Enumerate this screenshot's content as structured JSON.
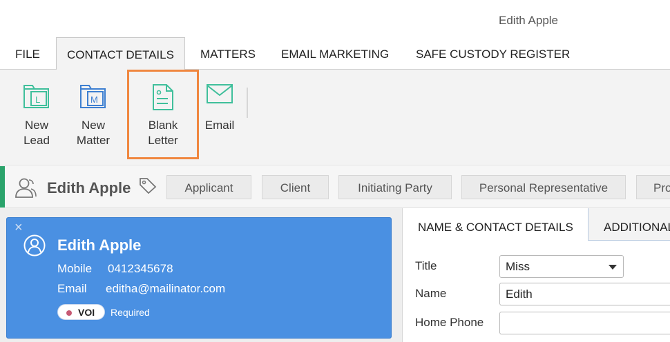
{
  "window": {
    "user_name": "Edith Apple"
  },
  "menu": {
    "tabs": [
      {
        "label": "FILE"
      },
      {
        "label": "CONTACT DETAILS"
      },
      {
        "label": "MATTERS"
      },
      {
        "label": "EMAIL MARKETING"
      },
      {
        "label": "SAFE CUSTODY REGISTER"
      }
    ],
    "active_tab": "CONTACT DETAILS"
  },
  "ribbon": {
    "buttons": [
      {
        "label_line1": "New",
        "label_line2": "Lead",
        "icon": "folder-l-icon"
      },
      {
        "label_line1": "New",
        "label_line2": "Matter",
        "icon": "folder-m-icon"
      },
      {
        "label_line1": "Blank",
        "label_line2": "Letter",
        "icon": "document-icon"
      },
      {
        "label_line1": "Email",
        "label_line2": "",
        "icon": "envelope-icon"
      }
    ],
    "highlighted": "Blank Letter",
    "colors": {
      "icon_teal": "#3fbf9b",
      "icon_blue": "#3d7fd1",
      "highlight": "#f0873f"
    }
  },
  "contact_bar": {
    "name": "Edith Apple",
    "roles": [
      "Applicant",
      "Client",
      "Initiating Party",
      "Personal Representative",
      "Pro"
    ],
    "accent_color": "#2aa36b"
  },
  "contact_card": {
    "name": "Edith Apple",
    "mobile_label": "Mobile",
    "mobile_value": "0412345678",
    "email_label": "Email",
    "email_value": "editha@mailinator.com",
    "badge": "VOI",
    "badge_status": "Required",
    "color": "#4a90e2"
  },
  "details_panel": {
    "tabs": [
      {
        "label": "NAME & CONTACT DETAILS"
      },
      {
        "label": "ADDITIONAL"
      }
    ],
    "fields": {
      "title_label": "Title",
      "title_value": "Miss",
      "name_label": "Name",
      "name_value": "Edith",
      "home_phone_label": "Home Phone",
      "home_phone_value": ""
    }
  }
}
